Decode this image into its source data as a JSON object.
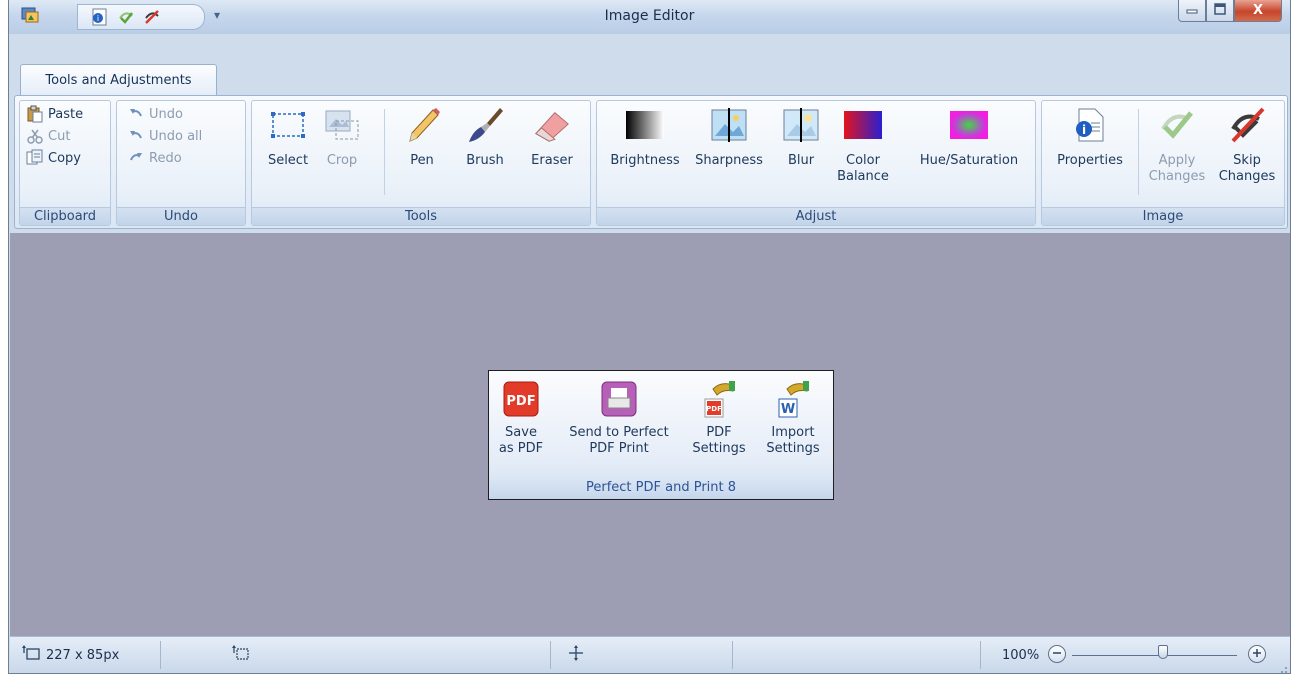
{
  "window": {
    "title": "Image Editor",
    "min_icon": "minimize-icon",
    "max_icon": "maximize-icon",
    "close_label": "X"
  },
  "qat": {
    "dropdown": "▾"
  },
  "tabs": [
    "Tools and Adjustments"
  ],
  "clipboard": {
    "label": "Clipboard",
    "paste": "Paste",
    "cut": "Cut",
    "copy": "Copy"
  },
  "undo": {
    "label": "Undo",
    "undo": "Undo",
    "undo_all": "Undo all",
    "redo": "Redo"
  },
  "tools": {
    "label": "Tools",
    "select": "Select",
    "crop": "Crop",
    "pen": "Pen",
    "brush": "Brush",
    "eraser": "Eraser"
  },
  "adjust": {
    "label": "Adjust",
    "brightness": "Brightness",
    "sharpness": "Sharpness",
    "blur": "Blur",
    "color_balance_1": "Color",
    "color_balance_2": "Balance",
    "hue": "Hue/Saturation"
  },
  "image": {
    "label": "Image",
    "properties": "Properties",
    "apply_1": "Apply",
    "apply_2": "Changes",
    "skip_1": "Skip",
    "skip_2": "Changes"
  },
  "popup": {
    "label": "Perfect PDF and Print 8",
    "save_1": "Save",
    "save_2": "as PDF",
    "send_1": "Send to Perfect",
    "send_2": "PDF  Print",
    "pdfset_1": "PDF",
    "pdfset_2": "Settings",
    "import_1": "Import",
    "import_2": "Settings",
    "pdf_icon_text": "PDF",
    "w_icon_text": "W"
  },
  "status": {
    "selection_size": "227 x 85px",
    "zoom": "100%"
  },
  "zoom_level": 0.55,
  "colors": {
    "canvas": "#9d9db3",
    "accent": "#1e395b"
  }
}
